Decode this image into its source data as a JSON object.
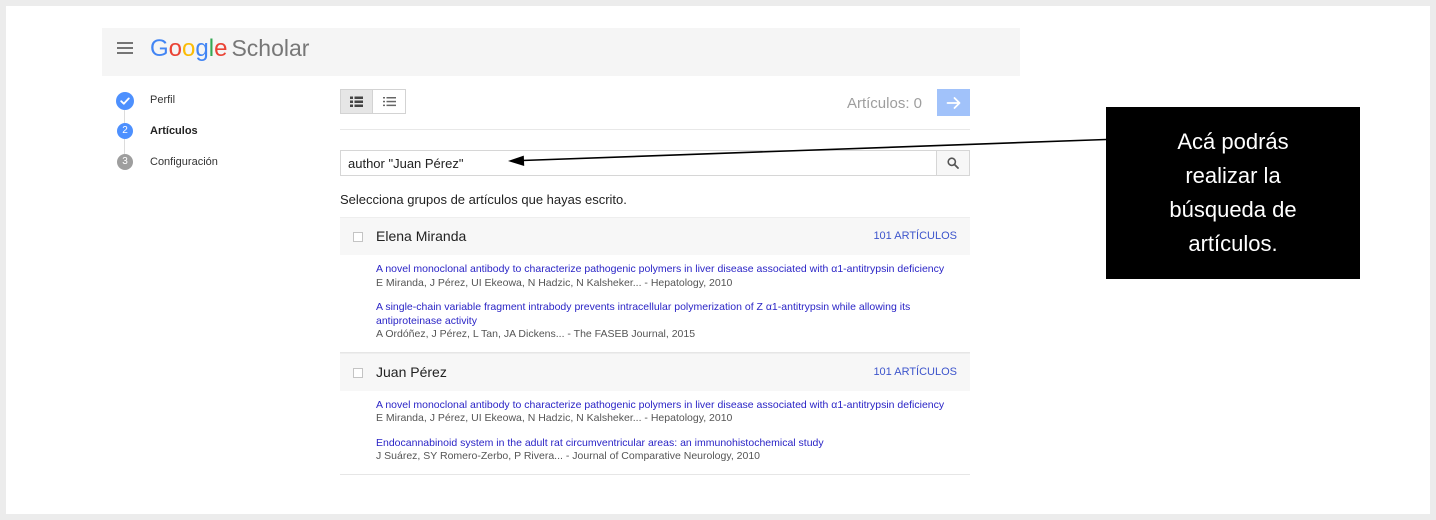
{
  "header": {
    "menu_icon": "menu-icon",
    "logo": {
      "brand": "Google",
      "product": "Scholar",
      "brand_colors": [
        "#4285f4",
        "#ea4335",
        "#fbbc05",
        "#4285f4",
        "#34a853",
        "#ea4335"
      ],
      "product_color": "#777777"
    }
  },
  "sidebar": {
    "steps": [
      {
        "label": "Perfil",
        "icon": "check-icon",
        "completed": true,
        "active": false
      },
      {
        "number": "2",
        "label": "Artículos",
        "completed": false,
        "active": true
      },
      {
        "number": "3",
        "label": "Configuración",
        "completed": false,
        "active": false
      }
    ]
  },
  "toolbar": {
    "view_buttons": [
      {
        "icon": "list-detailed-icon",
        "selected": true
      },
      {
        "icon": "list-compact-icon",
        "selected": false
      }
    ],
    "articles_count_label": "Artículos: 0",
    "next_button_icon": "arrow-right-icon"
  },
  "search": {
    "value": "author \"Juan Pérez\"",
    "button_icon": "search-icon"
  },
  "instruction": "Selecciona grupos de artículos que hayas escrito.",
  "groups": [
    {
      "name": "Elena Miranda",
      "count_label": "101 ARTÍCULOS",
      "articles": [
        {
          "title": "A novel monoclonal antibody to characterize pathogenic polymers in liver disease associated with α1-antitrypsin deficiency",
          "authors": "E Miranda, J Pérez, UI Ekeowa, N Hadzic, N Kalsheker... - Hepatology, 2010"
        },
        {
          "title": "A single-chain variable fragment intrabody prevents intracellular polymerization of Z α1-antitrypsin while allowing its antiproteinase activity",
          "authors": "A Ordóñez, J Pérez, L Tan, JA Dickens... - The FASEB Journal, 2015"
        }
      ]
    },
    {
      "name": "Juan Pérez",
      "count_label": "101 ARTÍCULOS",
      "articles": [
        {
          "title": "A novel monoclonal antibody to characterize pathogenic polymers in liver disease associated with α1-antitrypsin deficiency",
          "authors": "E Miranda, J Pérez, UI Ekeowa, N Hadzic, N Kalsheker... - Hepatology, 2010"
        },
        {
          "title": "Endocannabinoid system in the adult rat circumventricular areas: an immunohistochemical study",
          "authors": "J Suárez, SY Romero-Zerbo, P Rivera... - Journal of Comparative Neurology, 2010"
        }
      ]
    }
  ],
  "callout": {
    "lines": [
      "Acá podrás",
      "realizar la",
      "búsqueda de",
      "artículos."
    ]
  },
  "colors": {
    "accent": "#4d90fe",
    "next_button": "#a1c2fa",
    "link": "#2a24c6",
    "count_link": "#3d55cc",
    "callout_bg": "#000000"
  }
}
